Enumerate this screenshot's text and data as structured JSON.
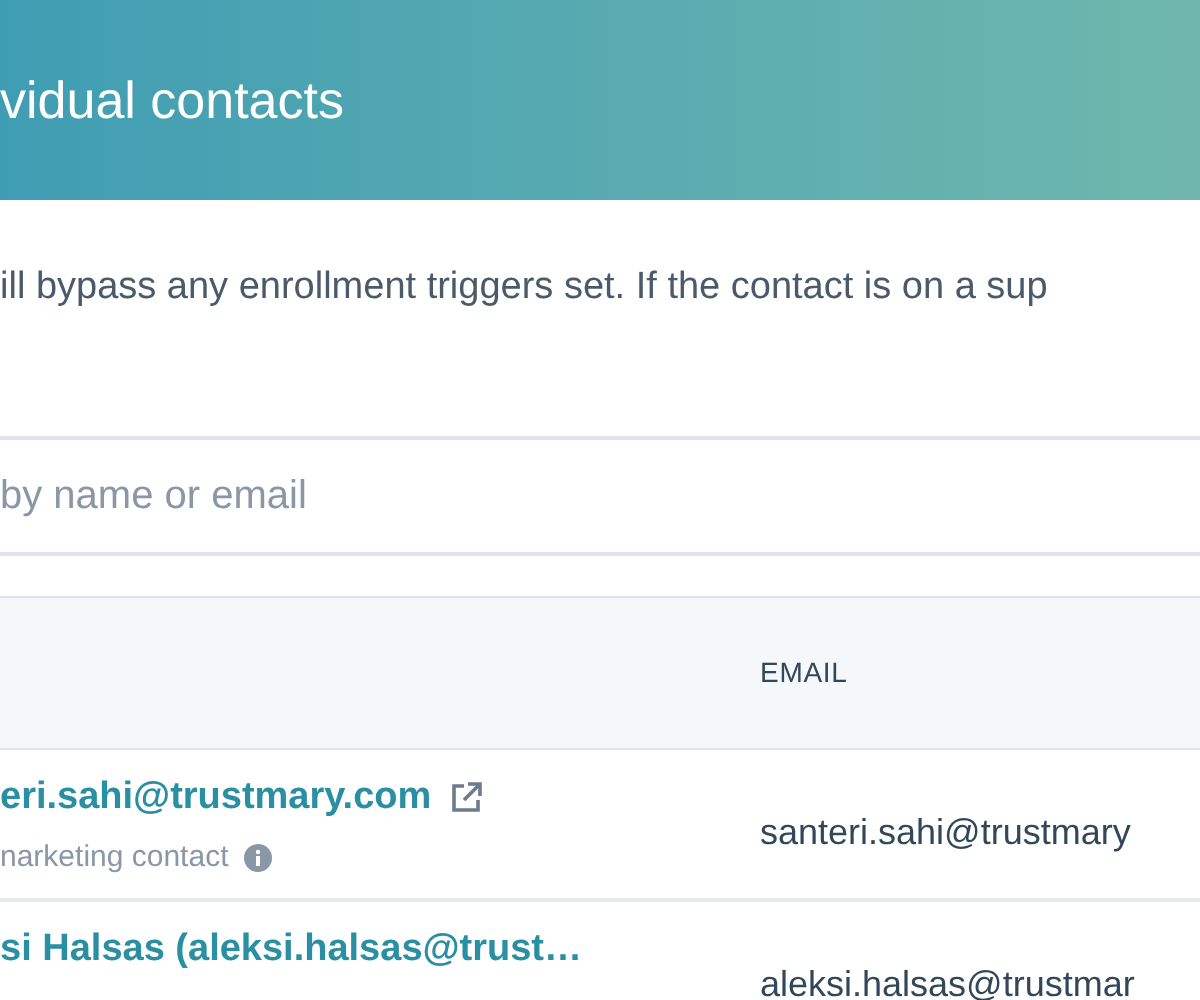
{
  "dialog": {
    "title": "vidual contacts"
  },
  "description": "ill bypass any enrollment triggers set. If the contact is on a sup",
  "search": {
    "placeholder": "by name or email"
  },
  "table": {
    "columns": [
      "EMAIL"
    ],
    "rows": [
      {
        "name": "eri.sahi@trustmary.com",
        "external_link": true,
        "note": "narketing contact",
        "email": "santeri.sahi@trustmary"
      },
      {
        "name": "si Halsas (aleksi.halsas@trust…",
        "external_link": false,
        "email": "aleksi.halsas@trustmar"
      }
    ]
  }
}
